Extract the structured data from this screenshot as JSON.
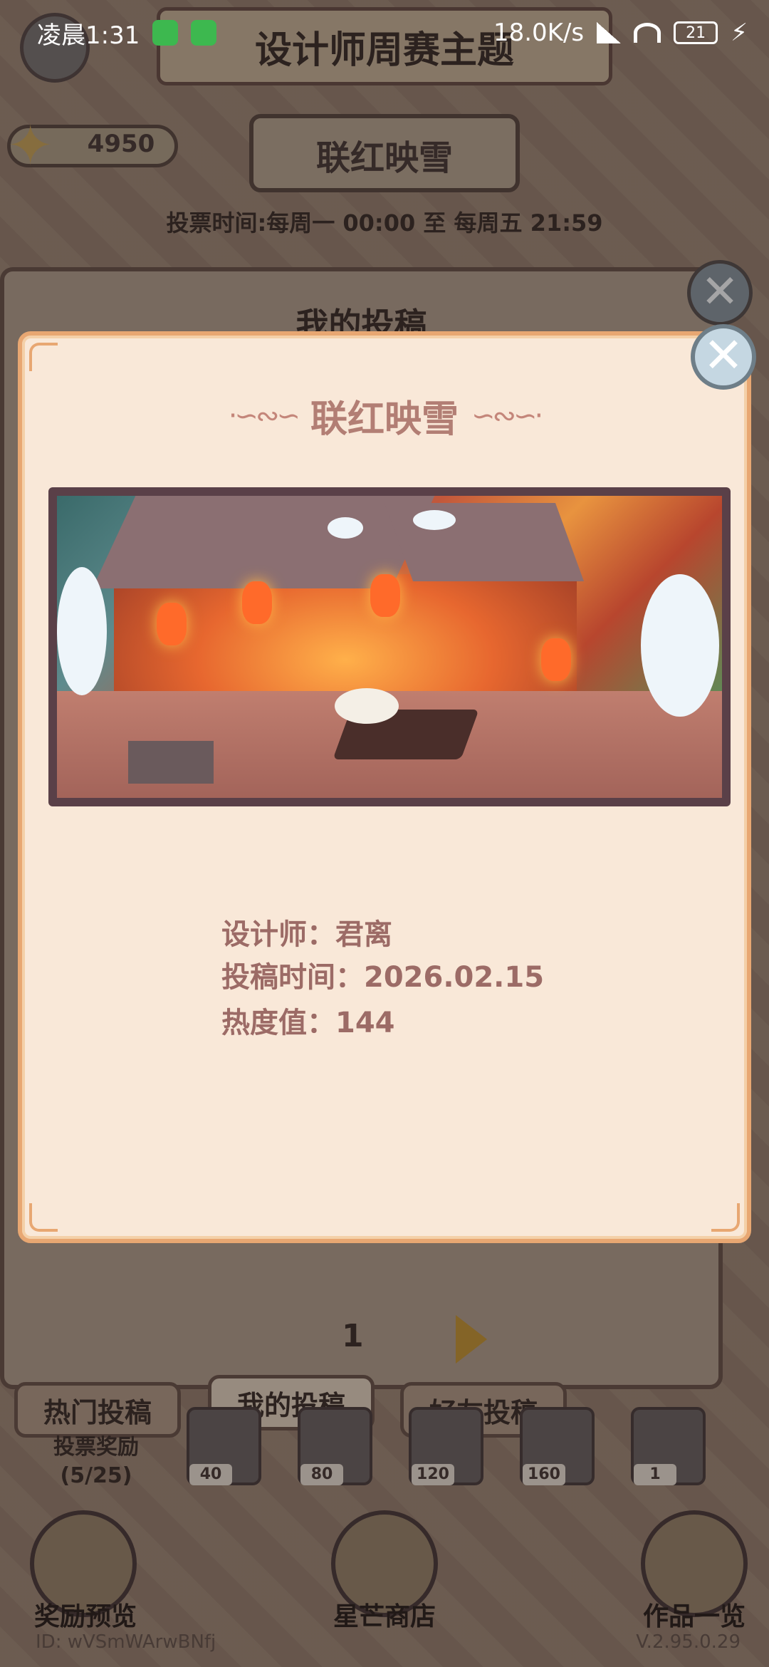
{
  "status_bar": {
    "time": "凌晨1:31",
    "net_speed": "18.0K/s",
    "battery": "21"
  },
  "header": {
    "title": "设计师周赛主题",
    "coins": "4950",
    "theme_name": "联红映雪",
    "vote_time": "投票时间:每周一 00:00 至 每周五 21:59"
  },
  "back_panel": {
    "title": "我的投稿",
    "page": "1"
  },
  "tabs": [
    {
      "label": "热门投稿"
    },
    {
      "label": "我的投稿"
    },
    {
      "label": "好友投稿"
    }
  ],
  "rewards": {
    "label": "投票奖励",
    "progress": "(5/25)",
    "slots": [
      "40",
      "80",
      "120",
      "160",
      "1"
    ]
  },
  "bottom_nav": [
    {
      "label": "奖励预览",
      "icon": "trophy-icon"
    },
    {
      "label": "星芒商店",
      "icon": "star-icon"
    },
    {
      "label": "作品一览",
      "icon": "book-icon"
    }
  ],
  "footer": {
    "id": "ID: wVSmWArwBNfj",
    "version": "V.2.95.0.29"
  },
  "modal": {
    "title": "联红映雪",
    "designer": "设计师：君离",
    "submit_time": "投稿时间：2026.02.15",
    "heat": "热度值：144"
  },
  "colors": {
    "modal_bg": "#f9e8d8",
    "modal_border": "#e8a772",
    "title_text": "#b27e74",
    "info_text": "#9c6b66"
  }
}
